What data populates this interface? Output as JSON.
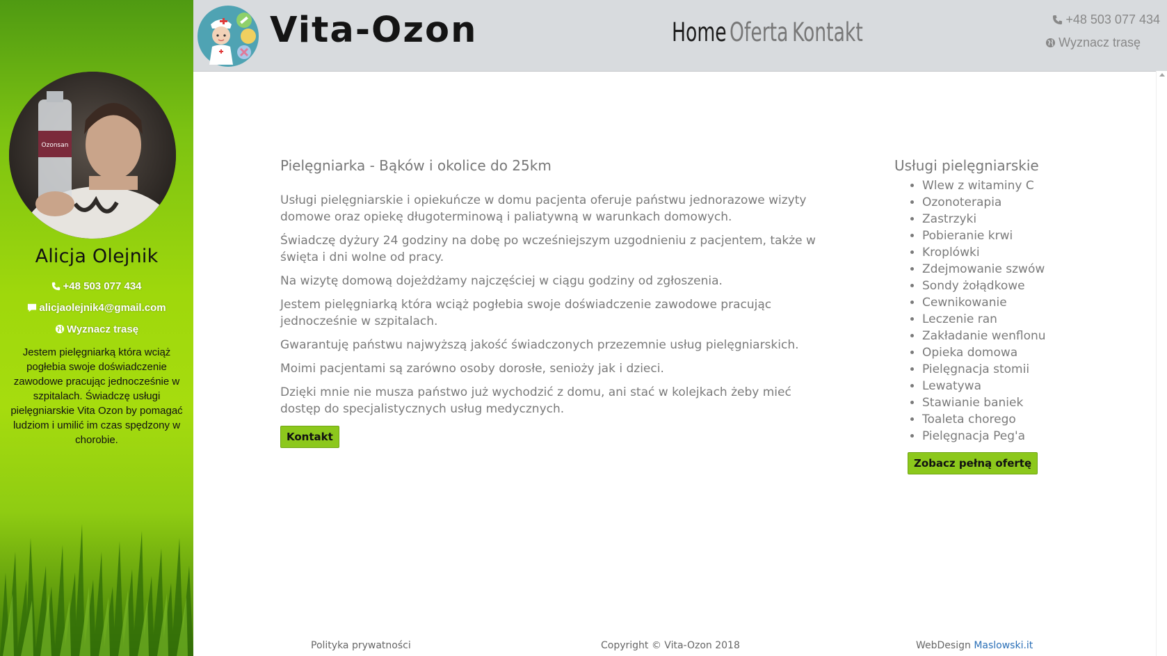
{
  "sidebar": {
    "name": "Alicja Olejnik",
    "phone": "+48 503 077 434",
    "email": "alicjaolejnik4@gmail.com",
    "route": "Wyznacz trasę",
    "about": "Jestem pielęgniarką która wciąż pogłebia swoje doświadczenie zawodowe pracując jednocześnie w szpitalach. Świadczę usługi pielęgniarskie Vita Ozon by pomagać ludziom i umilić im czas spędzony w chorobie.",
    "bottle_label": "Ozonsan"
  },
  "header": {
    "brand": "Vita-Ozon",
    "nav": [
      "Home",
      "Oferta",
      "Kontakt"
    ],
    "phone": "+48 503 077 434",
    "route": "Wyznacz trasę"
  },
  "main": {
    "title": "Pielęgniarka - Bąków i okolice do 25km",
    "paragraphs": [
      "Usługi pielęgniarskie i opiekuńcze w domu pacjenta oferuje państwu jednorazowe wizyty domowe oraz opiekę długoterminową i paliatywną w warunkach domowych.",
      "Świadczę dyżury 24 godziny na dobę po wcześniejszym uzgodnieniu z pacjentem, także w święta i dni wolne od pracy.",
      "Na wizytę domową dojeżdżamy najczęściej w ciągu godziny od zgłoszenia.",
      "Jestem pielęgniarką która wciąż pogłebia swoje doświadczenie zawodowe pracując jednocześnie w szpitalach.",
      "Gwarantuję państwu najwyższą jakość świadczonych przezemnie usług pielęgniarskich.",
      "Moimi pacjentami są zarówno osoby dorosłe, senioży jak i dzieci.",
      "Dzięki mnie nie musza państwo już wychodzić z domu, ani stać w kolejkach żeby mieć dostęp do specjalistycznych usług medycznych."
    ],
    "contact_button": "Kontakt"
  },
  "services": {
    "title": "Usługi pielęgniarskie",
    "items": [
      "Wlew z witaminy C",
      "Ozonoterapia",
      "Zastrzyki",
      "Pobieranie krwi",
      "Kroplówki",
      "Zdejmowanie szwów",
      "Sondy żołądkowe",
      "Cewnikowanie",
      "Leczenie ran",
      "Zakładanie wenflonu",
      "Opieka domowa",
      "Pielęgnacja stomii",
      "Lewatywa",
      "Stawianie baniek",
      "Toaleta chorego",
      "Pielęgnacja Peg'a"
    ],
    "offer_button": "Zobacz pełną ofertę"
  },
  "footer": {
    "privacy": "Polityka prywatności",
    "copyright": "Copyright © Vita-Ozon 2018",
    "design_prefix": "WebDesign",
    "design_link": "Maslowski.it"
  },
  "colors": {
    "accent_green": "#8cc81c",
    "header_bg": "#d8dbde",
    "link_blue": "#2a6fb7"
  }
}
